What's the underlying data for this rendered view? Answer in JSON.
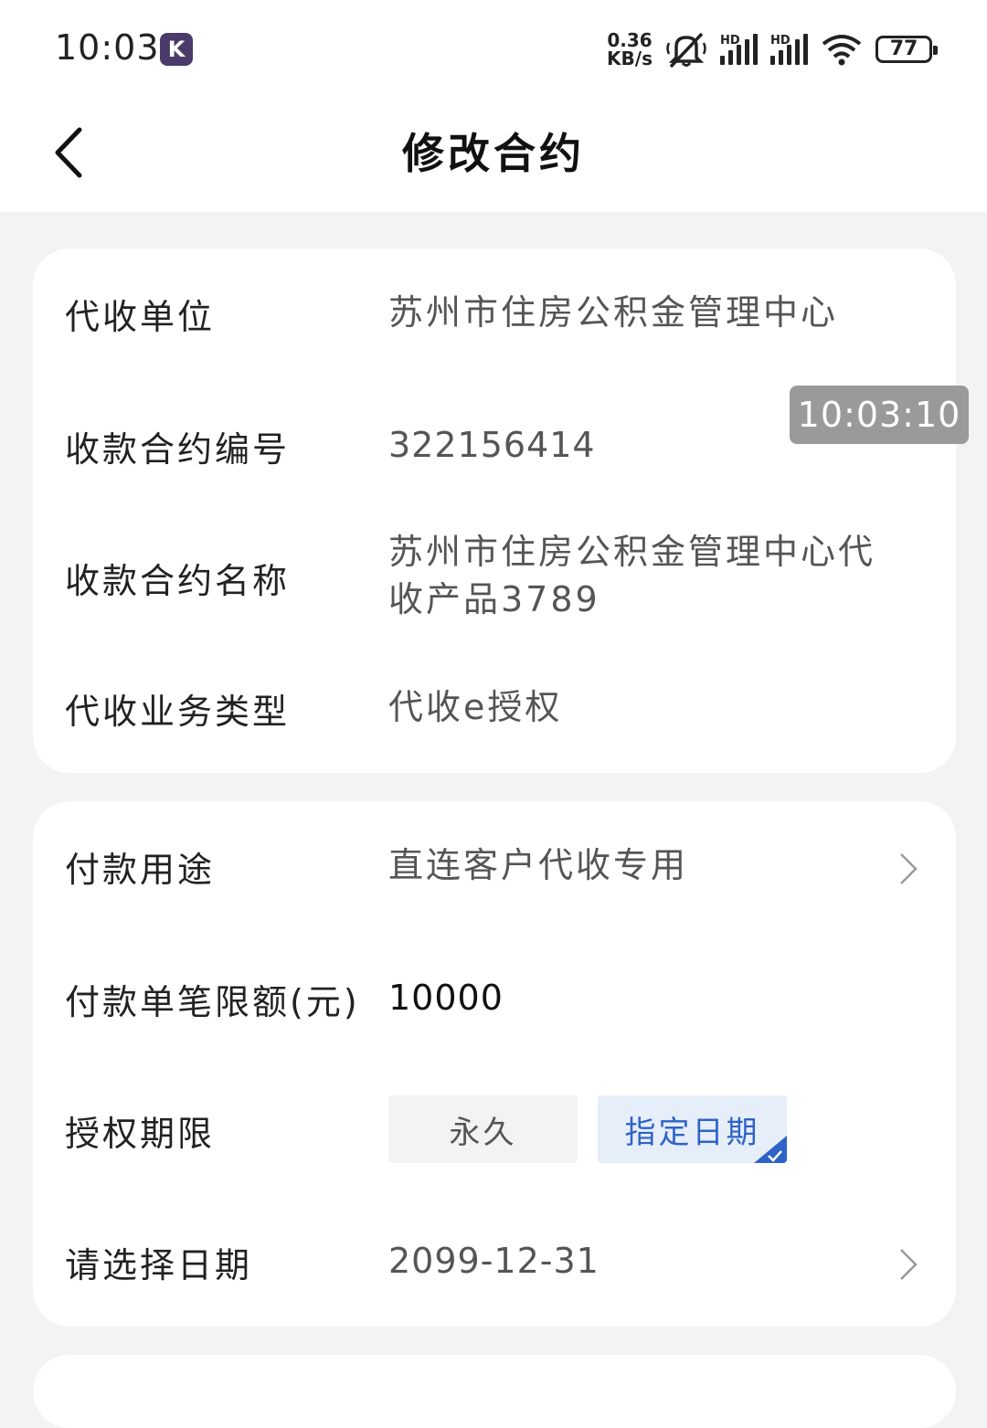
{
  "status_bar": {
    "time": "10:03",
    "app_icon_letter": "K",
    "net_speed_value": "0.36",
    "net_speed_unit": "KB/s",
    "signal_1_label": "HD",
    "signal_2_label": "HD",
    "battery": "77"
  },
  "nav": {
    "title": "修改合约"
  },
  "contract_info": {
    "collection_unit_label": "代收单位",
    "collection_unit_value": "苏州市住房公积金管理中心",
    "contract_no_label": "收款合约编号",
    "contract_no_value": "322156414",
    "contract_name_label": "收款合约名称",
    "contract_name_value": "苏州市住房公积金管理中心代收产品3789",
    "business_type_label": "代收业务类型",
    "business_type_value": "代收e授权"
  },
  "payment": {
    "purpose_label": "付款用途",
    "purpose_value": "直连客户代收专用",
    "limit_label": "付款单笔限额(元)",
    "limit_value": "10000",
    "auth_period_label": "授权期限",
    "auth_options": [
      "永久",
      "指定日期"
    ],
    "auth_selected": "指定日期",
    "date_label": "请选择日期",
    "date_value": "2099-12-31"
  },
  "overlay": {
    "timestamp": "10:03:10"
  },
  "colors": {
    "accent": "#2e63c7",
    "selected_bg": "#e6eefa",
    "page_bg": "#f3f3f3"
  }
}
